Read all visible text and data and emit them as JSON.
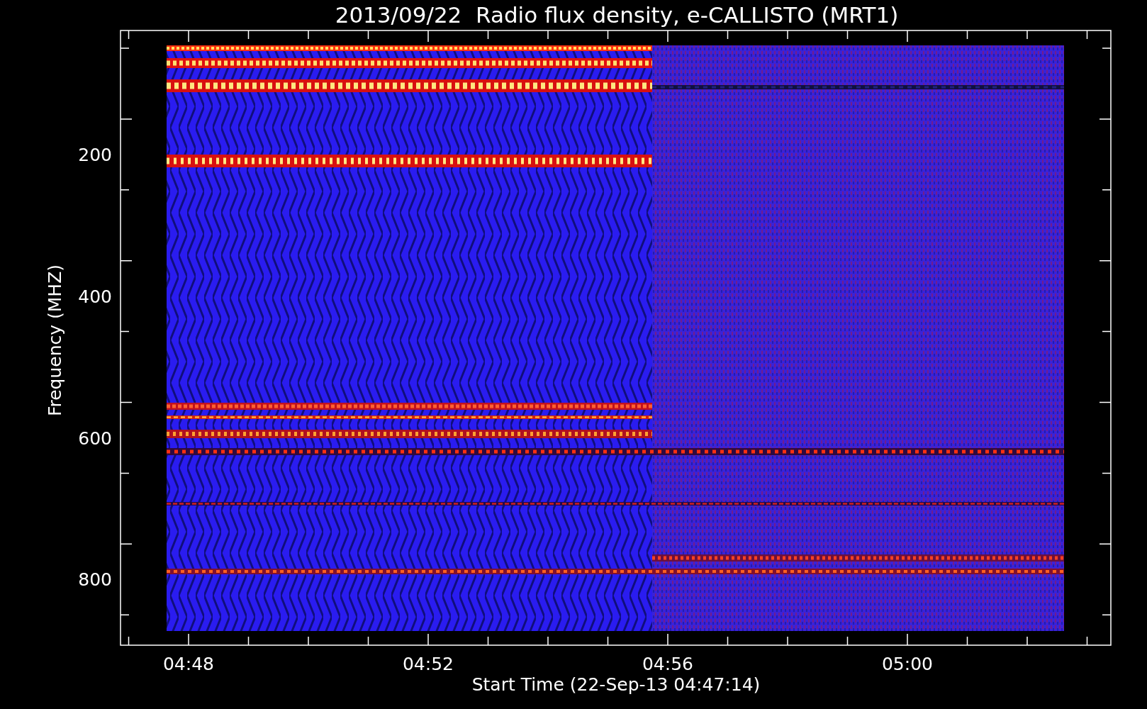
{
  "plot": {
    "title": "2013/09/22  Radio flux density, e-CALLISTO (MRT1)",
    "ylabel": "Frequency (MHZ)",
    "xlabel": "Start Time (22-Sep-13 04:47:14)",
    "y_tick_labels": [
      "200",
      "400",
      "600",
      "800"
    ],
    "x_tick_labels": [
      "04:48",
      "04:52",
      "04:56",
      "05:00"
    ]
  }
}
